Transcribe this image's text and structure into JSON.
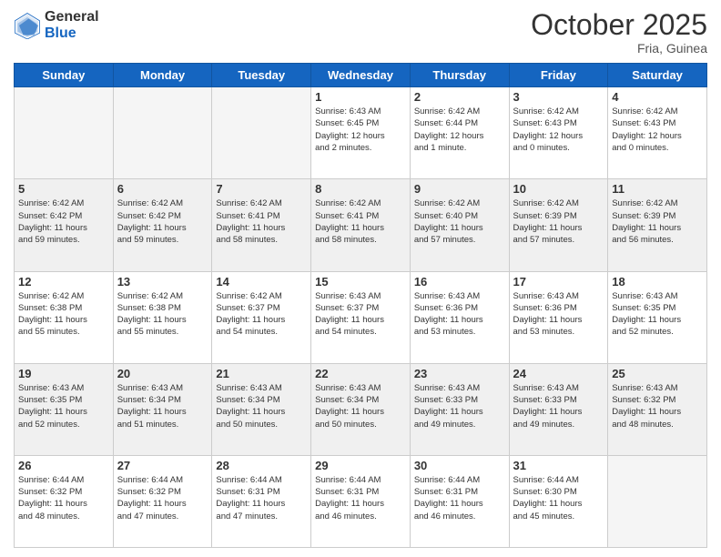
{
  "header": {
    "logo_general": "General",
    "logo_blue": "Blue",
    "month": "October 2025",
    "location": "Fria, Guinea"
  },
  "days_of_week": [
    "Sunday",
    "Monday",
    "Tuesday",
    "Wednesday",
    "Thursday",
    "Friday",
    "Saturday"
  ],
  "weeks": [
    [
      {
        "day": "",
        "info": ""
      },
      {
        "day": "",
        "info": ""
      },
      {
        "day": "",
        "info": ""
      },
      {
        "day": "1",
        "info": "Sunrise: 6:43 AM\nSunset: 6:45 PM\nDaylight: 12 hours\nand 2 minutes."
      },
      {
        "day": "2",
        "info": "Sunrise: 6:42 AM\nSunset: 6:44 PM\nDaylight: 12 hours\nand 1 minute."
      },
      {
        "day": "3",
        "info": "Sunrise: 6:42 AM\nSunset: 6:43 PM\nDaylight: 12 hours\nand 0 minutes."
      },
      {
        "day": "4",
        "info": "Sunrise: 6:42 AM\nSunset: 6:43 PM\nDaylight: 12 hours\nand 0 minutes."
      }
    ],
    [
      {
        "day": "5",
        "info": "Sunrise: 6:42 AM\nSunset: 6:42 PM\nDaylight: 11 hours\nand 59 minutes."
      },
      {
        "day": "6",
        "info": "Sunrise: 6:42 AM\nSunset: 6:42 PM\nDaylight: 11 hours\nand 59 minutes."
      },
      {
        "day": "7",
        "info": "Sunrise: 6:42 AM\nSunset: 6:41 PM\nDaylight: 11 hours\nand 58 minutes."
      },
      {
        "day": "8",
        "info": "Sunrise: 6:42 AM\nSunset: 6:41 PM\nDaylight: 11 hours\nand 58 minutes."
      },
      {
        "day": "9",
        "info": "Sunrise: 6:42 AM\nSunset: 6:40 PM\nDaylight: 11 hours\nand 57 minutes."
      },
      {
        "day": "10",
        "info": "Sunrise: 6:42 AM\nSunset: 6:39 PM\nDaylight: 11 hours\nand 57 minutes."
      },
      {
        "day": "11",
        "info": "Sunrise: 6:42 AM\nSunset: 6:39 PM\nDaylight: 11 hours\nand 56 minutes."
      }
    ],
    [
      {
        "day": "12",
        "info": "Sunrise: 6:42 AM\nSunset: 6:38 PM\nDaylight: 11 hours\nand 55 minutes."
      },
      {
        "day": "13",
        "info": "Sunrise: 6:42 AM\nSunset: 6:38 PM\nDaylight: 11 hours\nand 55 minutes."
      },
      {
        "day": "14",
        "info": "Sunrise: 6:42 AM\nSunset: 6:37 PM\nDaylight: 11 hours\nand 54 minutes."
      },
      {
        "day": "15",
        "info": "Sunrise: 6:43 AM\nSunset: 6:37 PM\nDaylight: 11 hours\nand 54 minutes."
      },
      {
        "day": "16",
        "info": "Sunrise: 6:43 AM\nSunset: 6:36 PM\nDaylight: 11 hours\nand 53 minutes."
      },
      {
        "day": "17",
        "info": "Sunrise: 6:43 AM\nSunset: 6:36 PM\nDaylight: 11 hours\nand 53 minutes."
      },
      {
        "day": "18",
        "info": "Sunrise: 6:43 AM\nSunset: 6:35 PM\nDaylight: 11 hours\nand 52 minutes."
      }
    ],
    [
      {
        "day": "19",
        "info": "Sunrise: 6:43 AM\nSunset: 6:35 PM\nDaylight: 11 hours\nand 52 minutes."
      },
      {
        "day": "20",
        "info": "Sunrise: 6:43 AM\nSunset: 6:34 PM\nDaylight: 11 hours\nand 51 minutes."
      },
      {
        "day": "21",
        "info": "Sunrise: 6:43 AM\nSunset: 6:34 PM\nDaylight: 11 hours\nand 50 minutes."
      },
      {
        "day": "22",
        "info": "Sunrise: 6:43 AM\nSunset: 6:34 PM\nDaylight: 11 hours\nand 50 minutes."
      },
      {
        "day": "23",
        "info": "Sunrise: 6:43 AM\nSunset: 6:33 PM\nDaylight: 11 hours\nand 49 minutes."
      },
      {
        "day": "24",
        "info": "Sunrise: 6:43 AM\nSunset: 6:33 PM\nDaylight: 11 hours\nand 49 minutes."
      },
      {
        "day": "25",
        "info": "Sunrise: 6:43 AM\nSunset: 6:32 PM\nDaylight: 11 hours\nand 48 minutes."
      }
    ],
    [
      {
        "day": "26",
        "info": "Sunrise: 6:44 AM\nSunset: 6:32 PM\nDaylight: 11 hours\nand 48 minutes."
      },
      {
        "day": "27",
        "info": "Sunrise: 6:44 AM\nSunset: 6:32 PM\nDaylight: 11 hours\nand 47 minutes."
      },
      {
        "day": "28",
        "info": "Sunrise: 6:44 AM\nSunset: 6:31 PM\nDaylight: 11 hours\nand 47 minutes."
      },
      {
        "day": "29",
        "info": "Sunrise: 6:44 AM\nSunset: 6:31 PM\nDaylight: 11 hours\nand 46 minutes."
      },
      {
        "day": "30",
        "info": "Sunrise: 6:44 AM\nSunset: 6:31 PM\nDaylight: 11 hours\nand 46 minutes."
      },
      {
        "day": "31",
        "info": "Sunrise: 6:44 AM\nSunset: 6:30 PM\nDaylight: 11 hours\nand 45 minutes."
      },
      {
        "day": "",
        "info": ""
      }
    ]
  ]
}
